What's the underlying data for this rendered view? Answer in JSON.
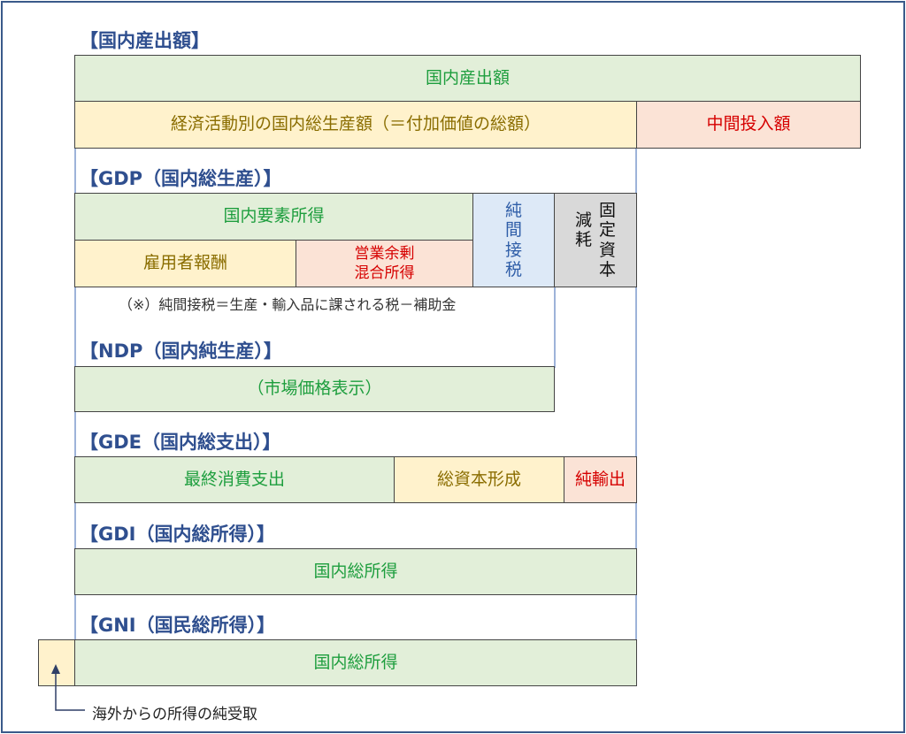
{
  "output": {
    "heading": "【国内産出額】",
    "total": "国内産出額",
    "value_added": "経済活動別の国内総生産額（＝付加価値の総額）",
    "intermediate": "中間投入額"
  },
  "gdp": {
    "heading": "【GDP（国内総生産）】",
    "factor_income": "国内要素所得",
    "compensation": "雇用者報酬",
    "surplus_line1": "営業余剰",
    "surplus_line2": "混合所得",
    "net_indirect_tax": "純間接税",
    "depreciation_col1": "固定資本",
    "depreciation_col2": "減耗",
    "note": "（※）純間接税＝生産・輸入品に課される税－補助金"
  },
  "ndp": {
    "heading": "【NDP（国内純生産）】",
    "market_price": "（市場価格表示）"
  },
  "gde": {
    "heading": "【GDE（国内総支出）】",
    "consumption": "最終消費支出",
    "capital_formation": "総資本形成",
    "net_exports": "純輸出"
  },
  "gdi": {
    "heading": "【GDI（国内総所得）】",
    "income": "国内総所得"
  },
  "gni": {
    "heading": "【GNI（国民総所得）】",
    "income": "国内総所得",
    "net_income_abroad": "海外からの所得の純受取"
  }
}
